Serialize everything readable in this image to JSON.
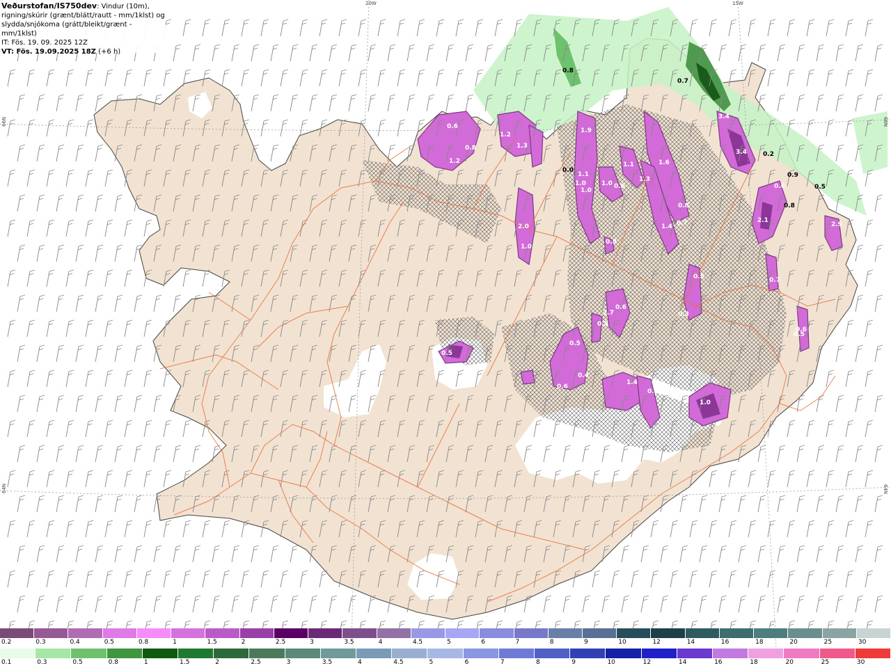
{
  "header": {
    "title": "Veðurstofan/IS750dev",
    "description_inline": ": Vindur (10m),",
    "description_line2": "rigning/skúrir (grænt/blátt/rautt - mm/1klst) og",
    "description_line3": "slydda/snjókoma (grátt/bleikt/grænt - mm/1klst)",
    "issue_time": "IT: Fös. 19. 09. 2025 12Z",
    "valid_time": "VT: Fös. 19.09.2025 18Z",
    "valid_offset": "(+6 h)"
  },
  "map": {
    "land_color": "#f2e2d2",
    "glacier_color": "#ffffff",
    "road_color": "#e8703a",
    "coastline_color": "#444444",
    "lon_labels": [
      "20W",
      "15W"
    ],
    "lat_labels_left": [
      "66N",
      "64N"
    ],
    "lat_labels_right": [
      "66N",
      "64N"
    ]
  },
  "precip_labels": {
    "snow": [
      "0.6",
      "0.8",
      "1.2",
      "1.2",
      "1.3",
      "1.9",
      "1.1",
      "1.0",
      "1.0",
      "1.1",
      "1.3",
      "1.6",
      "1.0",
      "0.6",
      "1.4",
      "0.7",
      "0.8",
      "2.0",
      "1.0",
      "0.8",
      "0.5",
      "0.5",
      "0.6",
      "0.4",
      "0.5",
      "1.4",
      "0.3",
      "1.0",
      "2.7",
      "0.6",
      "0.5",
      "0.3",
      "0.5",
      "3.4",
      "3.4",
      "2.1",
      "0.7",
      "2.9",
      "0.6",
      "0.9",
      "0.6",
      "0.8"
    ],
    "rain": [
      "0.8",
      "0.7",
      "0.0",
      "0.5",
      "0.2"
    ]
  },
  "legend": {
    "snow_scale": {
      "values": [
        "0.2",
        "0.3",
        "0.4",
        "0.5",
        "0.8",
        "1",
        "1.5",
        "2",
        "2.5",
        "3",
        "3.5",
        "4",
        "4.5",
        "5",
        "6",
        "7",
        "8",
        "9",
        "10",
        "12",
        "14",
        "16",
        "18",
        "20",
        "25",
        "30"
      ],
      "colors": [
        "#7a4a78",
        "#955a96",
        "#b06bb2",
        "#e07ae6",
        "#f58cf7",
        "#d472dc",
        "#b95bc6",
        "#9a3fa8",
        "#5a0064",
        "#6a2a76",
        "#7e4e8c",
        "#9370a6",
        "#9898e6",
        "#a6a6f2",
        "#8c8cdc",
        "#7878c8",
        "#6a7eaa",
        "#587094",
        "#264e5a",
        "#1c4048",
        "#2e5a62",
        "#3c6e70",
        "#4c7e7e",
        "#6a8e8e",
        "#8aa4a4",
        "#c8d4d4"
      ]
    },
    "rain_scale": {
      "values": [
        "0.1",
        "0.3",
        "0.5",
        "0.8",
        "1",
        "1.5",
        "2",
        "2.5",
        "3",
        "3.5",
        "4",
        "4.5",
        "5",
        "6",
        "7",
        "8",
        "9",
        "10",
        "12",
        "14",
        "16",
        "18",
        "20",
        "25",
        "30"
      ],
      "colors": [
        "#e8fbe8",
        "#a6e6a6",
        "#6ec26e",
        "#3f963f",
        "#0e5a0e",
        "#1d7a30",
        "#2c6a3c",
        "#4a7a5a",
        "#5c8a7a",
        "#6e9a9a",
        "#7a9ab8",
        "#9aaed2",
        "#a8b8e6",
        "#8a96e2",
        "#6e7ad6",
        "#5060c6",
        "#3240b6",
        "#1420a6",
        "#2020c8",
        "#6a3ad0",
        "#c07ae0",
        "#f0a0e0",
        "#f07ac0",
        "#f05a8a",
        "#f03a3a",
        "#ff0000"
      ]
    }
  }
}
